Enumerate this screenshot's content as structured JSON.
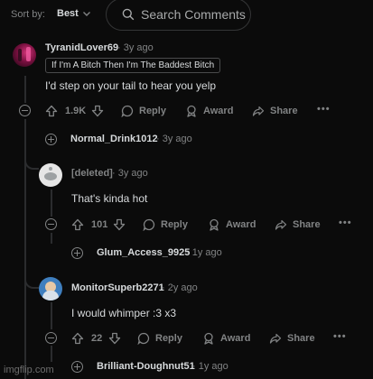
{
  "sort": {
    "label": "Sort by:",
    "value": "Best"
  },
  "search": {
    "placeholder": "Search Comments"
  },
  "actions": {
    "reply": "Reply",
    "award": "Award",
    "share": "Share"
  },
  "comments": [
    {
      "user": "TyranidLover69",
      "time": "· 3y ago",
      "flair": "If I'm A Bitch Then I'm The Baddest Bitch",
      "body": "I'd step on your tail to hear you yelp",
      "votes": "1.9K"
    },
    {
      "user": "Normal_Drink1012",
      "time": "· 3y ago"
    },
    {
      "user": "[deleted]",
      "time": "· 3y ago",
      "body": "That's kinda hot",
      "votes": "101"
    },
    {
      "user": "Glum_Access_9925",
      "time": "· 1y ago"
    },
    {
      "user": "MonitorSuperb2271",
      "time": "· 2y ago",
      "body": "I would whimper :3 x3",
      "votes": "22"
    },
    {
      "user": "Brilliant-Doughnut51",
      "time": "· 1y ago"
    }
  ],
  "watermark": "imgflip.com",
  "colors": {
    "background": "#0b0b0b",
    "text": "#d7dadc",
    "muted": "#818384",
    "thread_line": "#2b2c2e"
  }
}
